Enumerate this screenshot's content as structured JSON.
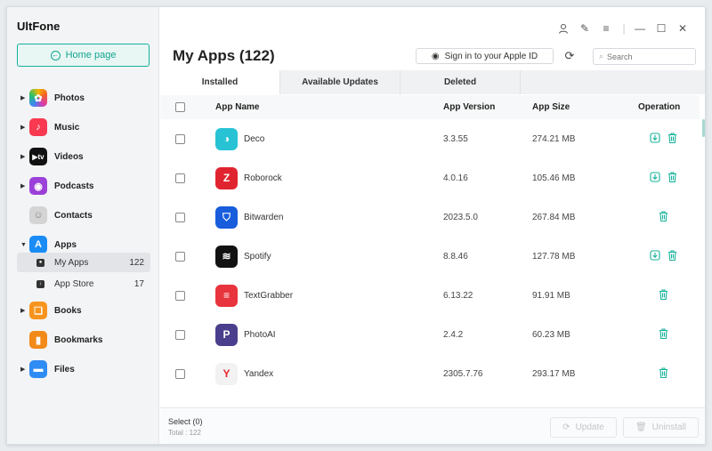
{
  "app": {
    "title": "UltFone"
  },
  "sidebar": {
    "home_label": "Home page",
    "items": [
      {
        "label": "Photos",
        "icon": "photos-icon"
      },
      {
        "label": "Music",
        "icon": "music-icon"
      },
      {
        "label": "Videos",
        "icon": "tv-icon"
      },
      {
        "label": "Podcasts",
        "icon": "podcasts-icon"
      },
      {
        "label": "Contacts",
        "icon": "contacts-icon"
      },
      {
        "label": "Apps",
        "icon": "app-store-icon"
      },
      {
        "label": "Books",
        "icon": "books-icon"
      },
      {
        "label": "Bookmarks",
        "icon": "bookmark-icon"
      },
      {
        "label": "Files",
        "icon": "folder-icon"
      }
    ],
    "subitems": [
      {
        "label": "My Apps",
        "count": "122"
      },
      {
        "label": "App Store",
        "count": "17"
      }
    ]
  },
  "header": {
    "title": "My Apps (122)",
    "sign_in": "Sign in to your Apple ID",
    "search_placeholder": "Search"
  },
  "tabs": [
    "Installed",
    "Available Updates",
    "Deleted"
  ],
  "table": {
    "columns": [
      "App Name",
      "App Version",
      "App Size",
      "Operation"
    ],
    "rows": [
      {
        "name": "Deco",
        "version": "3.3.55",
        "size": "274.21 MB",
        "color": "#27c3d4",
        "glyph": "◑",
        "update": true
      },
      {
        "name": "Roborock",
        "version": "4.0.16",
        "size": "105.46 MB",
        "color": "#e0242f",
        "glyph": "Z",
        "update": true
      },
      {
        "name": "Bitwarden",
        "version": "2023.5.0",
        "size": "267.84 MB",
        "color": "#175ddc",
        "glyph": "⛉",
        "update": false
      },
      {
        "name": "Spotify",
        "version": "8.8.46",
        "size": "127.78 MB",
        "color": "#121212",
        "glyph": "≋",
        "update": true
      },
      {
        "name": "TextGrabber",
        "version": "6.13.22",
        "size": "91.91 MB",
        "color": "#e8343c",
        "glyph": "≡",
        "update": false
      },
      {
        "name": "PhotoAI",
        "version": "2.4.2",
        "size": "60.23 MB",
        "color": "#4a3f8c",
        "glyph": "P",
        "update": false
      },
      {
        "name": "Yandex",
        "version": "2305.7.76",
        "size": "293.17 MB",
        "color": "#f2f2f2",
        "glyph": "Y",
        "update": false
      }
    ]
  },
  "footer": {
    "select": "Select (0)",
    "total": "Total : 122",
    "update": "Update",
    "uninstall": "Uninstall"
  },
  "colors": {
    "accent": "#15b19a",
    "sidebar_bg": "#f3f4f6"
  }
}
